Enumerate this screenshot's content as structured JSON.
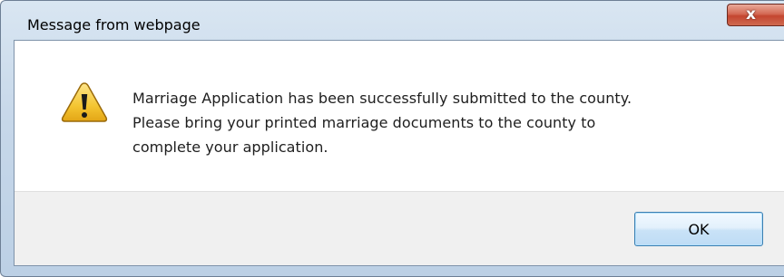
{
  "dialog": {
    "title": "Message from webpage",
    "close_glyph": "x",
    "icon": "warning-icon",
    "message_lines": [
      "Marriage Application has been successfully submitted to the county.",
      "Please bring your printed marriage documents to the county to",
      "complete your application."
    ],
    "ok_label": "OK"
  },
  "colors": {
    "title_bar": "#c9d9ea",
    "close_button": "#c9503a",
    "warning_fill": "#f4c531",
    "button_area": "#f0f0f0",
    "ok_border": "#3c7fb1"
  }
}
